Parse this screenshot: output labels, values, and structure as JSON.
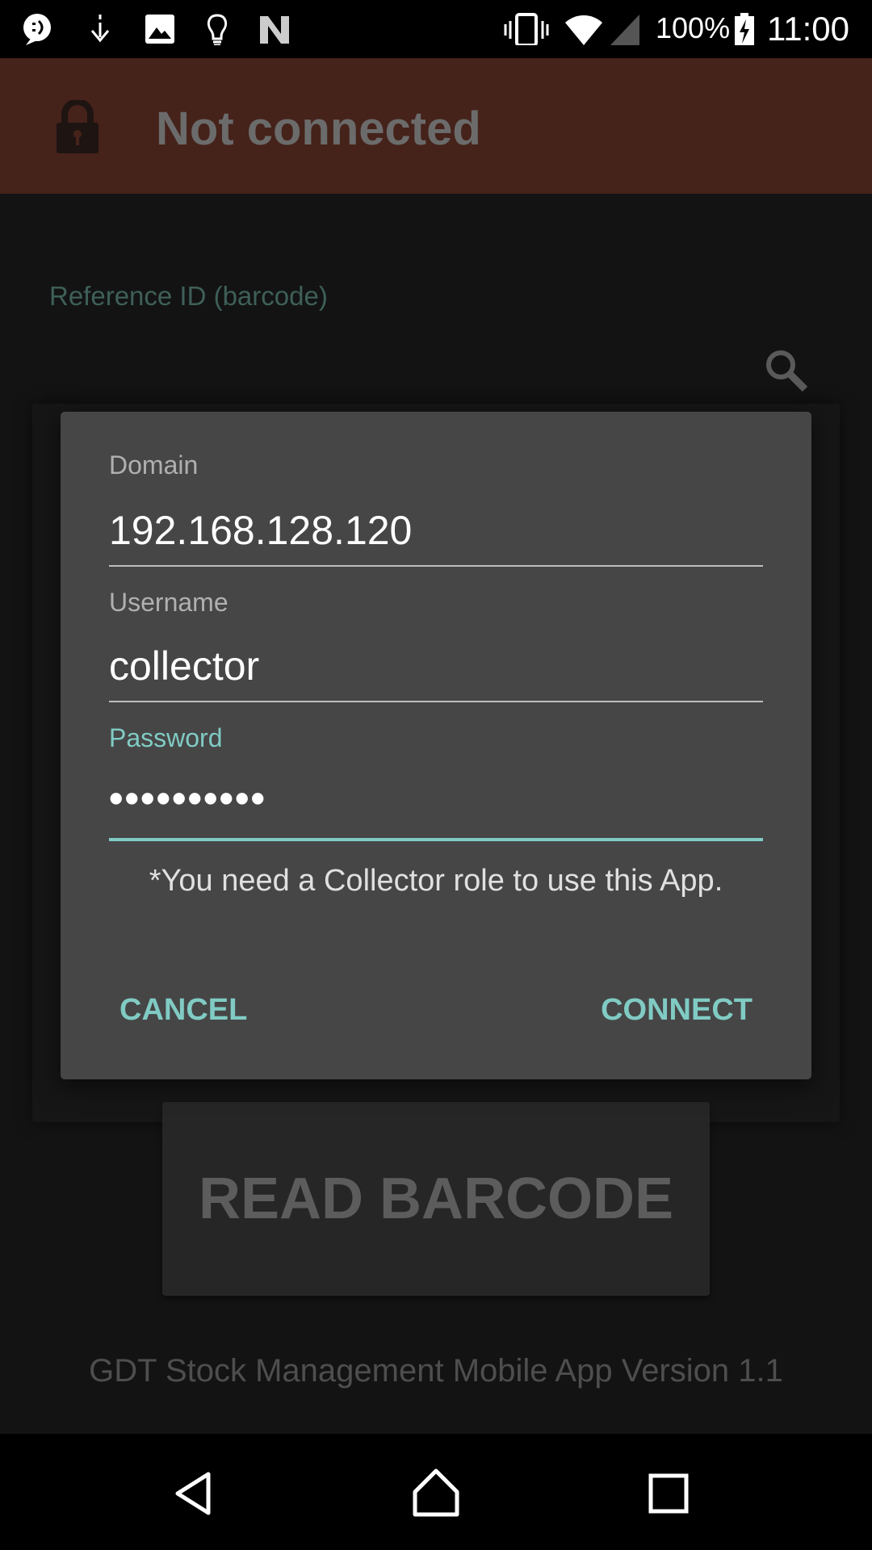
{
  "status_bar": {
    "left_icons": [
      "messenger-icon",
      "download-icon",
      "image-icon",
      "lightbulb-icon",
      "n-logo-icon"
    ],
    "right_icons": [
      "vibrate-icon",
      "wifi-icon",
      "signal-icon",
      "battery-charging-icon"
    ],
    "battery": "100%",
    "time": "11:00"
  },
  "app_bar": {
    "icon": "lock-icon",
    "title": "Not connected",
    "color": "#45221a"
  },
  "reference": {
    "label": "Reference ID (barcode)",
    "value": "",
    "icon": "search-icon"
  },
  "dialog": {
    "domain": {
      "label": "Domain",
      "value": "192.168.128.120"
    },
    "username": {
      "label": "Username",
      "value": "collector"
    },
    "password": {
      "label": "Password",
      "value": "••••••••••"
    },
    "note": "*You need a Collector role to use this App.",
    "cancel_label": "CANCEL",
    "connect_label": "CONNECT",
    "accent": "#80cbc4"
  },
  "read_barcode_label": "READ BARCODE",
  "footer": "GDT Stock Management Mobile App Version 1.1",
  "nav_bar": [
    "back-icon",
    "home-icon",
    "recents-icon"
  ]
}
